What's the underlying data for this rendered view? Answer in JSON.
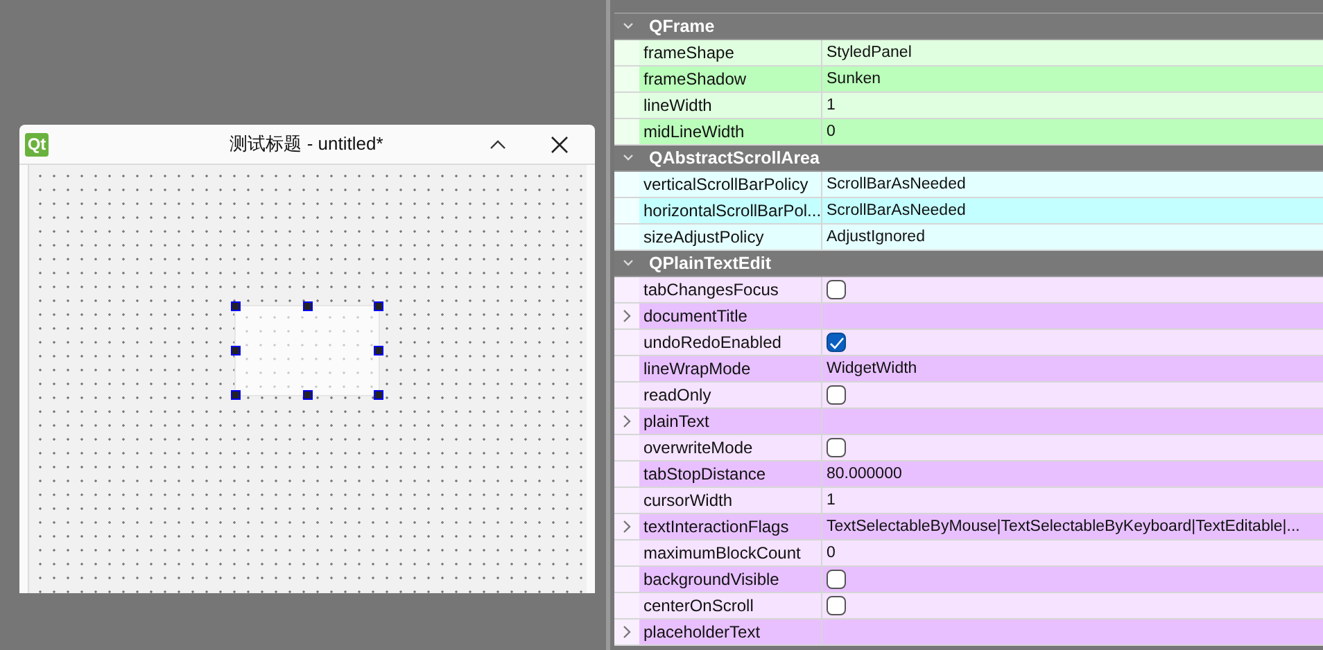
{
  "form_window": {
    "logo": "Qt",
    "title": "测试标题 - untitled*"
  },
  "property_editor": {
    "sections": [
      {
        "name": "QFrame",
        "expanded": true,
        "color": "#bbfebb",
        "rows": [
          {
            "name": "frameShape",
            "kind": "text",
            "value": "StyledPanel",
            "expandable": false
          },
          {
            "name": "frameShadow",
            "kind": "text",
            "value": "Sunken",
            "expandable": false
          },
          {
            "name": "lineWidth",
            "kind": "text",
            "value": "1",
            "expandable": false
          },
          {
            "name": "midLineWidth",
            "kind": "text",
            "value": "0",
            "expandable": false
          }
        ]
      },
      {
        "name": "QAbstractScrollArea",
        "expanded": true,
        "color": "#c4ffff",
        "rows": [
          {
            "name": "verticalScrollBarPolicy",
            "kind": "text",
            "value": "ScrollBarAsNeeded",
            "expandable": false
          },
          {
            "name": "horizontalScrollBarPol...",
            "kind": "text",
            "value": "ScrollBarAsNeeded",
            "expandable": false
          },
          {
            "name": "sizeAdjustPolicy",
            "kind": "text",
            "value": "AdjustIgnored",
            "expandable": false
          }
        ]
      },
      {
        "name": "QPlainTextEdit",
        "expanded": true,
        "color": "#e8c0ff",
        "rows": [
          {
            "name": "tabChangesFocus",
            "kind": "checkbox",
            "checked": false,
            "expandable": false
          },
          {
            "name": "documentTitle",
            "kind": "text",
            "expandable": true
          },
          {
            "name": "undoRedoEnabled",
            "kind": "checkbox",
            "checked": true,
            "expandable": false
          },
          {
            "name": "lineWrapMode",
            "kind": "text",
            "value": "WidgetWidth",
            "expandable": false
          },
          {
            "name": "readOnly",
            "kind": "checkbox",
            "checked": false,
            "expandable": false
          },
          {
            "name": "plainText",
            "kind": "text",
            "expandable": true
          },
          {
            "name": "overwriteMode",
            "kind": "checkbox",
            "checked": false,
            "expandable": false
          },
          {
            "name": "tabStopDistance",
            "kind": "text",
            "value": "80.000000",
            "expandable": false
          },
          {
            "name": "cursorWidth",
            "kind": "text",
            "value": "1",
            "expandable": false
          },
          {
            "name": "textInteractionFlags",
            "kind": "text",
            "value": "TextSelectableByMouse|TextSelectableByKeyboard|TextEditable|...",
            "expandable": true
          },
          {
            "name": "maximumBlockCount",
            "kind": "text",
            "value": "0",
            "expandable": false
          },
          {
            "name": "backgroundVisible",
            "kind": "checkbox",
            "checked": false,
            "expandable": false
          },
          {
            "name": "centerOnScroll",
            "kind": "checkbox",
            "checked": false,
            "expandable": false
          },
          {
            "name": "placeholderText",
            "kind": "text",
            "expandable": true
          }
        ]
      }
    ]
  }
}
